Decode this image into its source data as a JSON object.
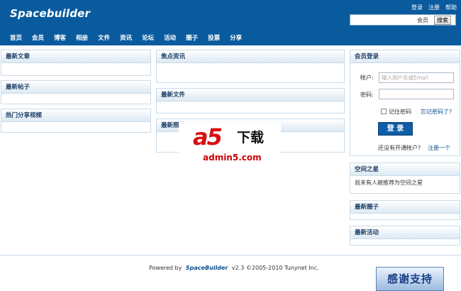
{
  "header": {
    "logo": "Spacebuilder",
    "toplinks": [
      "登录",
      "注册",
      "帮助"
    ],
    "search": {
      "placeholder": "",
      "scope": "会员",
      "button": "搜索"
    },
    "nav": [
      "首页",
      "会员",
      "博客",
      "相册",
      "文件",
      "资讯",
      "论坛",
      "活动",
      "圈子",
      "投票",
      "分享"
    ]
  },
  "left_panels": [
    {
      "title": "最新文章"
    },
    {
      "title": "最新帖子"
    },
    {
      "title": "热门分享视频"
    }
  ],
  "middle_panels": [
    {
      "title": "焦点资讯"
    },
    {
      "title": "最新文件"
    },
    {
      "title": "最新照片"
    }
  ],
  "login": {
    "title": "会员登录",
    "account_label": "帐户:",
    "account_placeholder": "输入用户名或Email",
    "password_label": "密码:",
    "remember": "记住密码",
    "forgot": "忘记密码了?",
    "button": "登 录",
    "no_account": "还没有开通帐户?",
    "register": "注册一个"
  },
  "right_panels": [
    {
      "title": "空间之星",
      "body": "尚未有人被推荐为空间之星"
    },
    {
      "title": "最新圈子"
    },
    {
      "title": "最新活动"
    }
  ],
  "watermark": {
    "logo": "a5",
    "download": "下载",
    "url": "admin5.com"
  },
  "footer": {
    "powered_by": "Powered by",
    "brand": "SpaceBuilder",
    "version": "v2.3 ©2005-2010 Tunynet Inc."
  },
  "thanks": "感谢支持"
}
